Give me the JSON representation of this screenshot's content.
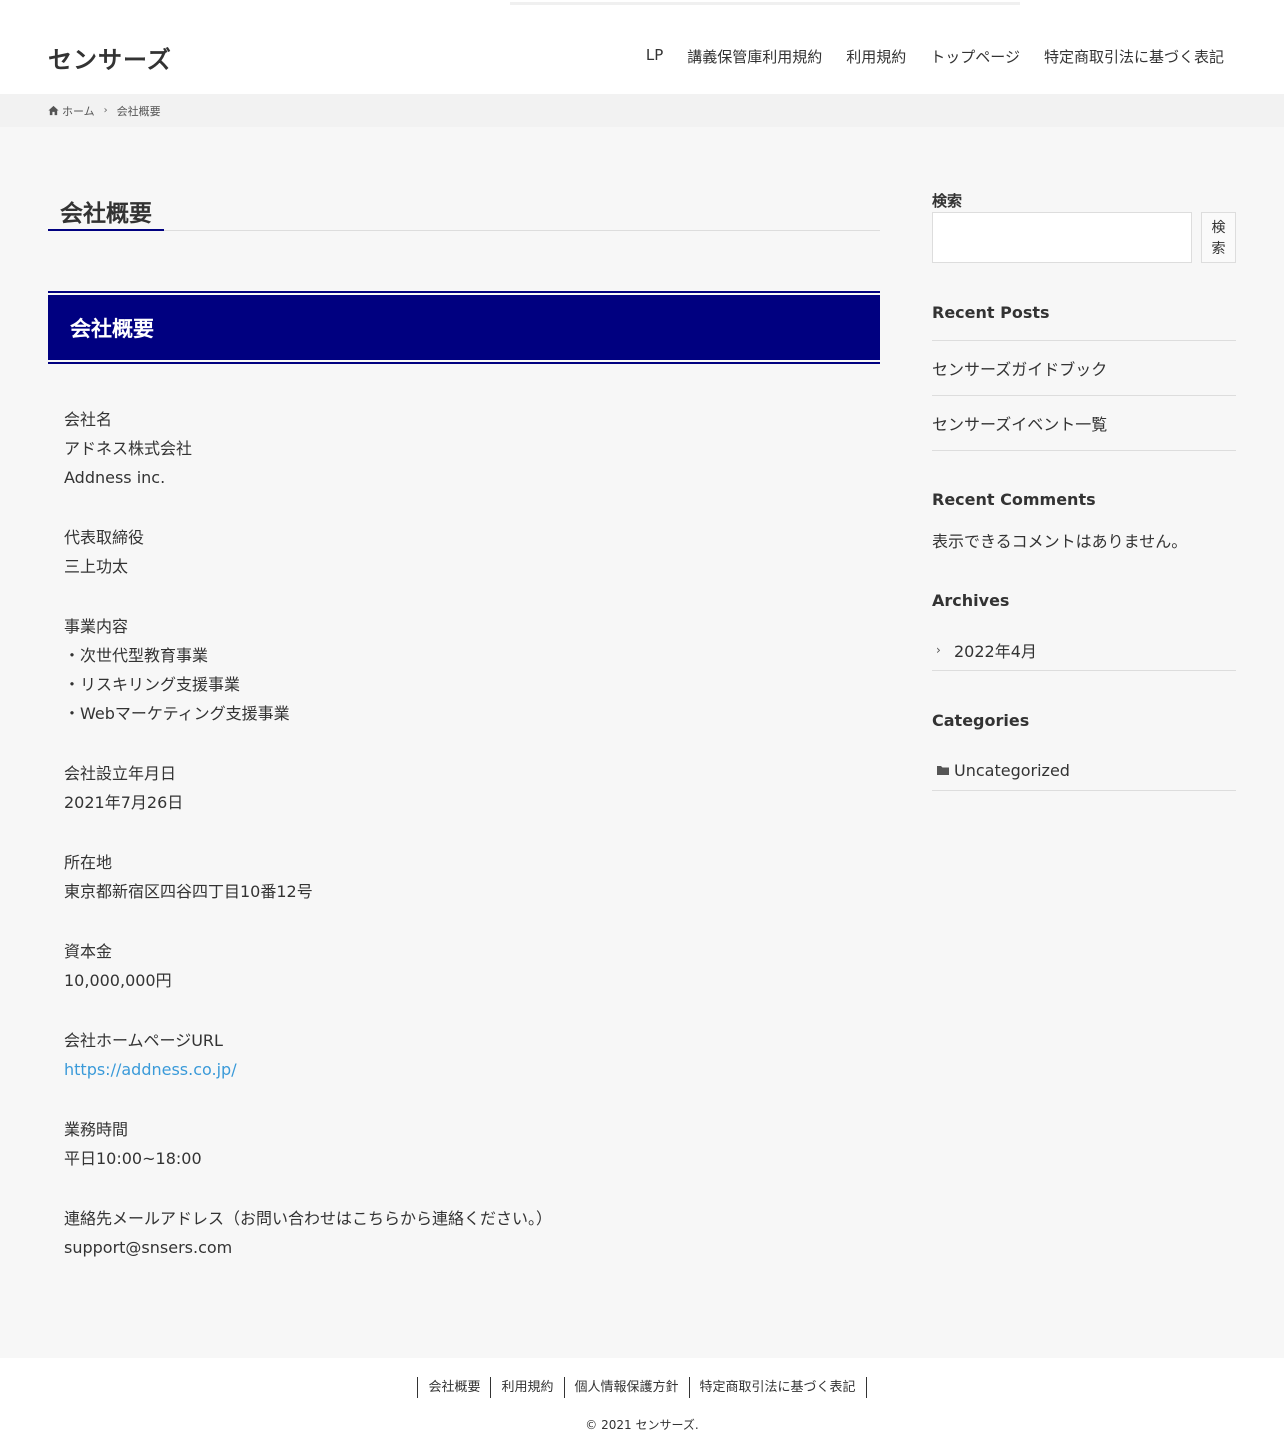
{
  "header": {
    "site_title": "センサーズ",
    "nav": [
      "LP",
      "講義保管庫利用規約",
      "利用規約",
      "トップページ",
      "特定商取引法に基づく表記"
    ]
  },
  "breadcrumb": {
    "home": "ホーム",
    "current": "会社概要"
  },
  "main": {
    "page_title": "会社概要",
    "section_heading": "会社概要",
    "info_blocks": [
      {
        "lines": [
          "会社名",
          "アドネス株式会社",
          "Addness inc."
        ]
      },
      {
        "lines": [
          "代表取締役",
          "三上功太"
        ]
      },
      {
        "lines": [
          "事業内容",
          "・次世代型教育事業",
          "・リスキリング支援事業",
          "・Webマーケティング支援事業"
        ]
      },
      {
        "lines": [
          "会社設立年月日",
          "2021年7月26日"
        ]
      },
      {
        "lines": [
          "所在地",
          "東京都新宿区四谷四丁目10番12号"
        ]
      },
      {
        "lines": [
          "資本金",
          "10,000,000円"
        ]
      },
      {
        "lines": [
          "会社ホームページURL"
        ],
        "link": "https://addness.co.jp/"
      },
      {
        "lines": [
          "業務時間",
          "平日10:00~18:00"
        ]
      },
      {
        "lines": [
          "連絡先メールアドレス（お問い合わせはこちらから連絡ください。）",
          "support@snsers.com"
        ]
      }
    ]
  },
  "sidebar": {
    "search_label": "検索",
    "search_button": "検索",
    "search_button_lines": [
      "検",
      "索"
    ],
    "recent_posts_title": "Recent Posts",
    "recent_posts": [
      "センサーズガイドブック",
      "センサーズイベント一覧"
    ],
    "recent_comments_title": "Recent Comments",
    "no_comments": "表示できるコメントはありません。",
    "archives_title": "Archives",
    "archives": [
      "2022年4月"
    ],
    "categories_title": "Categories",
    "categories": [
      "Uncategorized"
    ]
  },
  "footer": {
    "nav": [
      "会社概要",
      "利用規約",
      "個人情報保護方針",
      "特定商取引法に基づく表記"
    ],
    "copyright": "© 2021 センサーズ."
  },
  "colors": {
    "accent_navy": "#000080",
    "link_blue": "#3a9ad9"
  }
}
